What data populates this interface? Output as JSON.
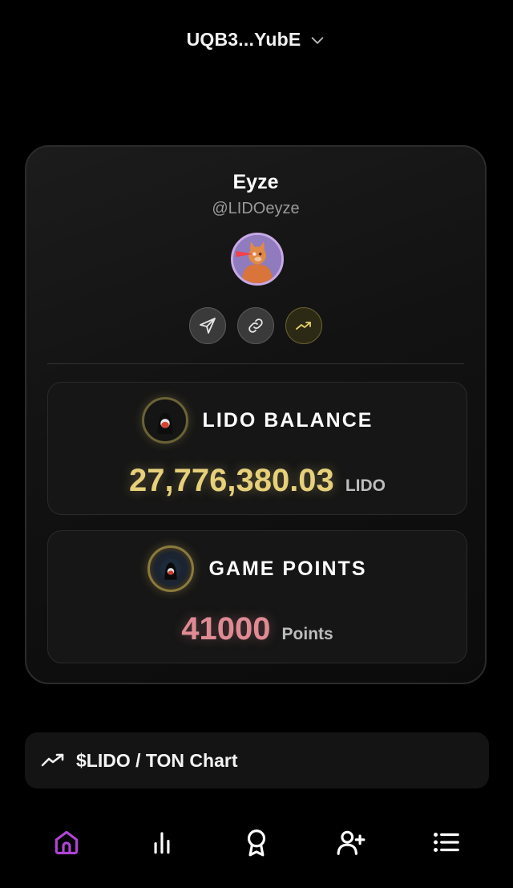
{
  "wallet": {
    "address": "UQB3...YubE"
  },
  "profile": {
    "name": "Eyze",
    "handle": "@LIDOeyze"
  },
  "actions": [
    "send-icon",
    "link-icon",
    "trending-up-icon"
  ],
  "balance": {
    "title": "LIDO BALANCE",
    "amount": "27,776,380.03",
    "unit": "LIDO"
  },
  "points": {
    "title": "GAME POINTS",
    "amount": "41000",
    "unit": "Points"
  },
  "chart_link": {
    "label": "$LIDO / TON Chart"
  },
  "nav": [
    "home-icon",
    "stats-icon",
    "badge-icon",
    "add-friend-icon",
    "menu-icon"
  ],
  "colors": {
    "accent": "#b044d6",
    "gold": "#e6d07a",
    "pink": "#e08a93"
  }
}
